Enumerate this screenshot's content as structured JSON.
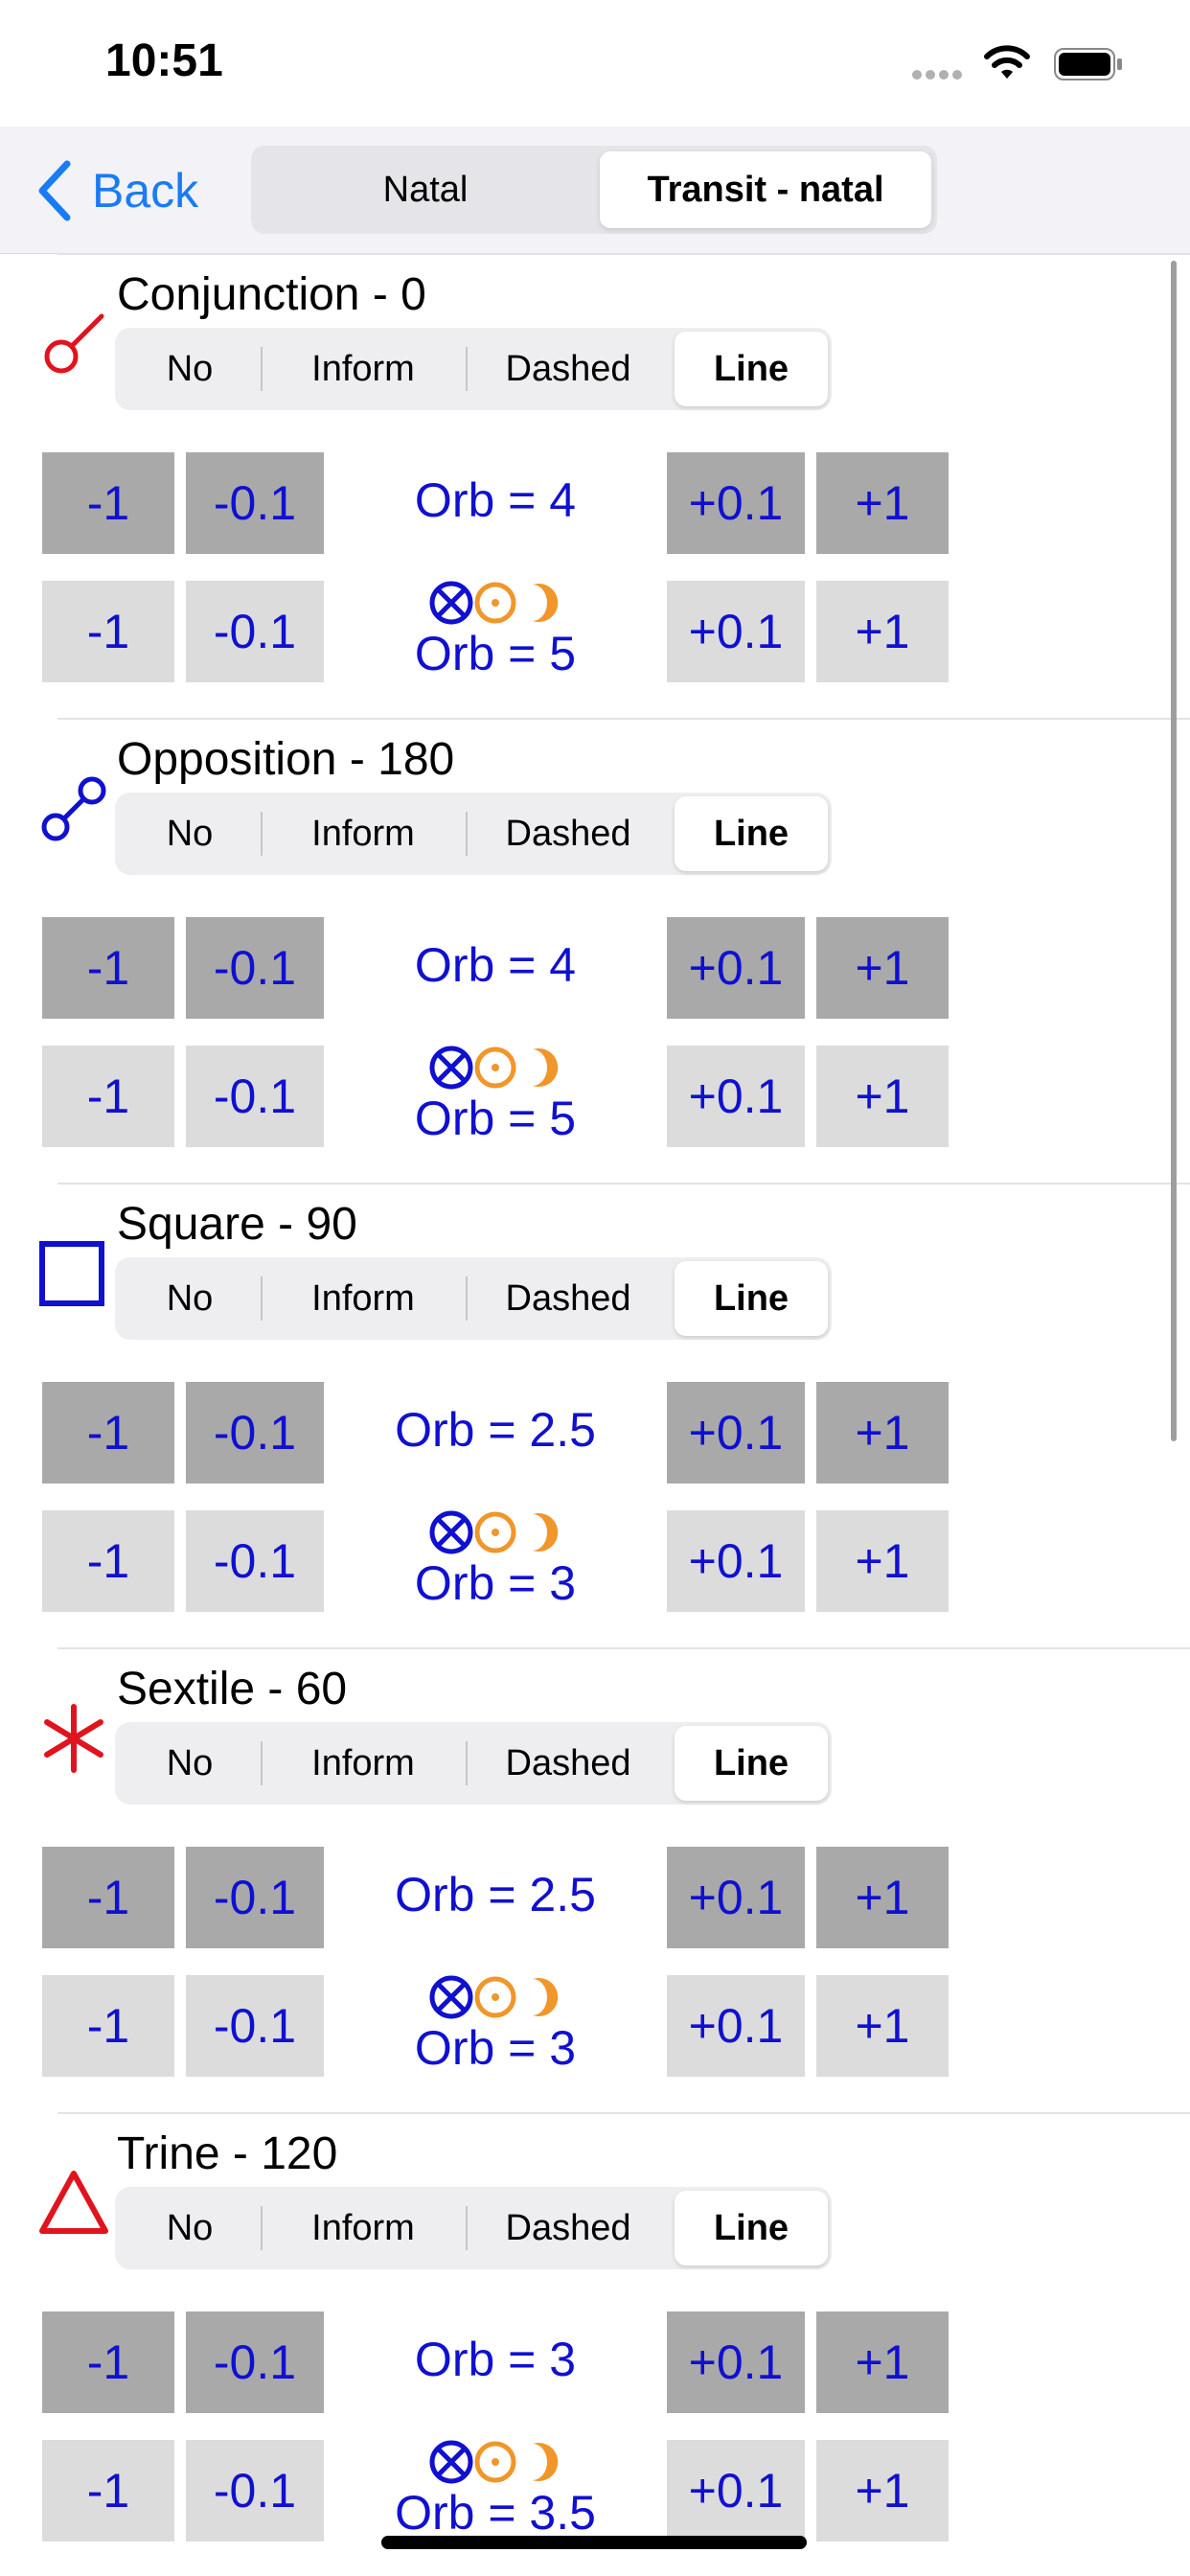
{
  "status": {
    "time": "10:51"
  },
  "nav": {
    "back_label": "Back",
    "tabs": [
      "Natal",
      "Transit - natal"
    ],
    "selected_tab": "Transit - natal"
  },
  "options": [
    "No",
    "Inform",
    "Dashed",
    "Line"
  ],
  "buttons": {
    "minus_one": "-1",
    "minus_tenth": "-0.1",
    "plus_tenth": "+0.1",
    "plus_one": "+1"
  },
  "colors": {
    "accent": "#1a7cf3",
    "value_blue": "#1010d0",
    "red_symbol": "#e0141e",
    "blue_symbol": "#1010d0",
    "orange_symbol": "#f0962a"
  },
  "aspects": [
    {
      "title": "Conjunction - 0",
      "icon": "conjunction-icon",
      "selected": "Line",
      "orb": "Orb = 4",
      "orb_luminaries": "Orb = 5"
    },
    {
      "title": "Opposition - 180",
      "icon": "opposition-icon",
      "selected": "Line",
      "orb": "Orb = 4",
      "orb_luminaries": "Orb = 5"
    },
    {
      "title": "Square - 90",
      "icon": "square-icon",
      "selected": "Line",
      "orb": "Orb = 2.5",
      "orb_luminaries": "Orb = 3"
    },
    {
      "title": "Sextile - 60",
      "icon": "sextile-icon",
      "selected": "Line",
      "orb": "Orb = 2.5",
      "orb_luminaries": "Orb = 3"
    },
    {
      "title": "Trine - 120",
      "icon": "trine-icon",
      "selected": "Line",
      "orb": "Orb = 3",
      "orb_luminaries": "Orb = 3.5"
    }
  ]
}
